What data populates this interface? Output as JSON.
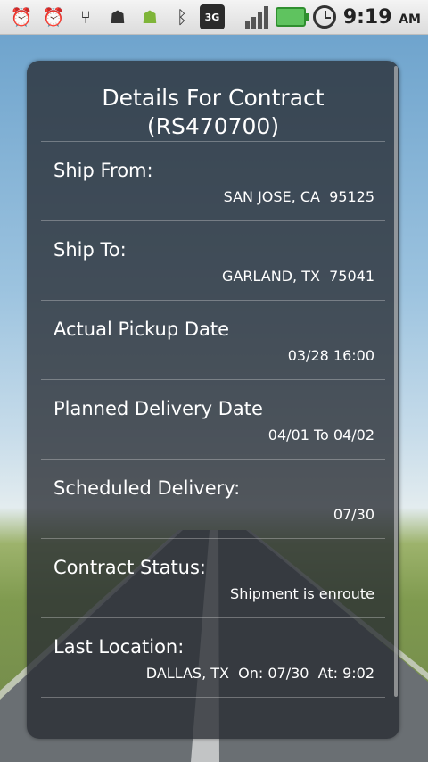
{
  "status_bar": {
    "icons": [
      "alarm-sd-icon",
      "alarm-sd-icon",
      "usb-icon",
      "android-debug-icon",
      "android-icon",
      "bluetooth-icon",
      "network-3g-icon",
      "signal-icon",
      "battery-charging-icon",
      "alarm-clock-icon"
    ],
    "network_label": "3G",
    "time": "9:19",
    "ampm": "AM"
  },
  "card": {
    "title_line1": "Details For Contract",
    "title_line2": "(RS470700)",
    "rows": [
      {
        "label": "Ship From:",
        "value": "SAN JOSE, CA  95125"
      },
      {
        "label": "Ship To:",
        "value": "GARLAND, TX  75041"
      },
      {
        "label": "Actual Pickup Date",
        "value": "03/28 16:00"
      },
      {
        "label": "Planned Delivery Date",
        "value": "04/01 To 04/02"
      },
      {
        "label": "Scheduled Delivery:",
        "value": "07/30"
      },
      {
        "label": "Contract Status:",
        "value": "Shipment is enroute"
      },
      {
        "label": "Last Location:",
        "value": "DALLAS, TX  On: 07/30  At: 9:02"
      }
    ]
  }
}
